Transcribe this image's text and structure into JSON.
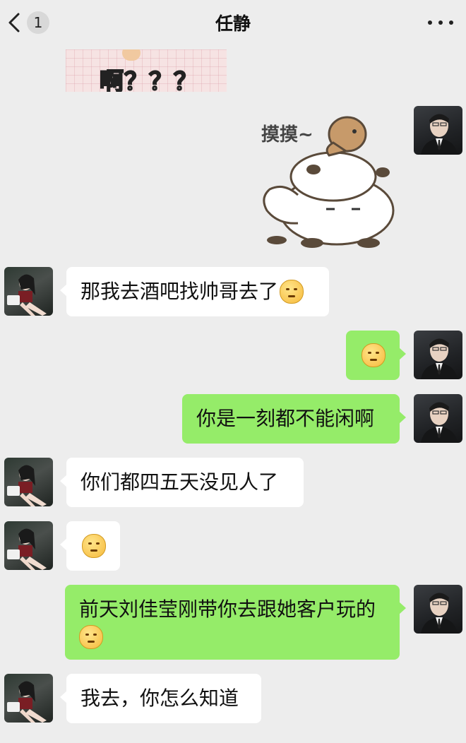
{
  "header": {
    "unread_count": "1",
    "title": "任静"
  },
  "stickers": {
    "top_caption": "啊？？？",
    "pat_caption": "摸摸~"
  },
  "messages": [
    {
      "from": "her",
      "text": "那我去酒吧找帅哥去了"
    },
    {
      "from": "me",
      "text": ""
    },
    {
      "from": "me",
      "text": "你是一刻都不能闲啊"
    },
    {
      "from": "her",
      "text": "你们都四五天没见人了"
    },
    {
      "from": "her",
      "text": ""
    },
    {
      "from": "me",
      "text": "前天刘佳莹刚带你去跟她客户玩的"
    },
    {
      "from": "her",
      "text": "我去，你怎么知道"
    }
  ],
  "colors": {
    "bg": "#ededed",
    "my_bubble": "#95ec69",
    "her_bubble": "#ffffff"
  }
}
